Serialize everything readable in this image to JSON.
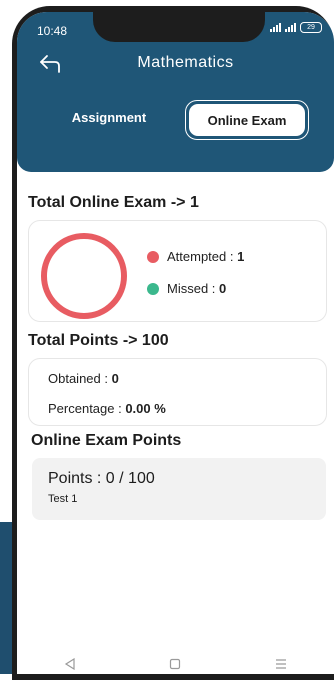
{
  "status_bar": {
    "time": "10:48",
    "battery": "29"
  },
  "header": {
    "title": "Mathematics"
  },
  "tabs": [
    {
      "label": "Assignment",
      "active": false
    },
    {
      "label": "Online Exam",
      "active": true
    }
  ],
  "exam_summary": {
    "title": "Total Online Exam -> 1",
    "attempted_label": "Attempted : ",
    "attempted_value": "1",
    "missed_label": "Missed : ",
    "missed_value": "0",
    "attempted_fraction": 1.0,
    "colors": {
      "attempted": "#e85c62",
      "missed": "#3bb88d"
    }
  },
  "points_summary": {
    "title": "Total Points -> 100",
    "obtained_label": "Obtained : ",
    "obtained_value": "0",
    "percentage_label": "Percentage : ",
    "percentage_value": "0.00 %"
  },
  "exam_points": {
    "title": "Online Exam Points",
    "items": [
      {
        "points": "Points : 0 / 100",
        "name": "Test 1"
      }
    ]
  },
  "colors": {
    "header": "#1f5677",
    "phone_frame": "#1d1d1d"
  }
}
